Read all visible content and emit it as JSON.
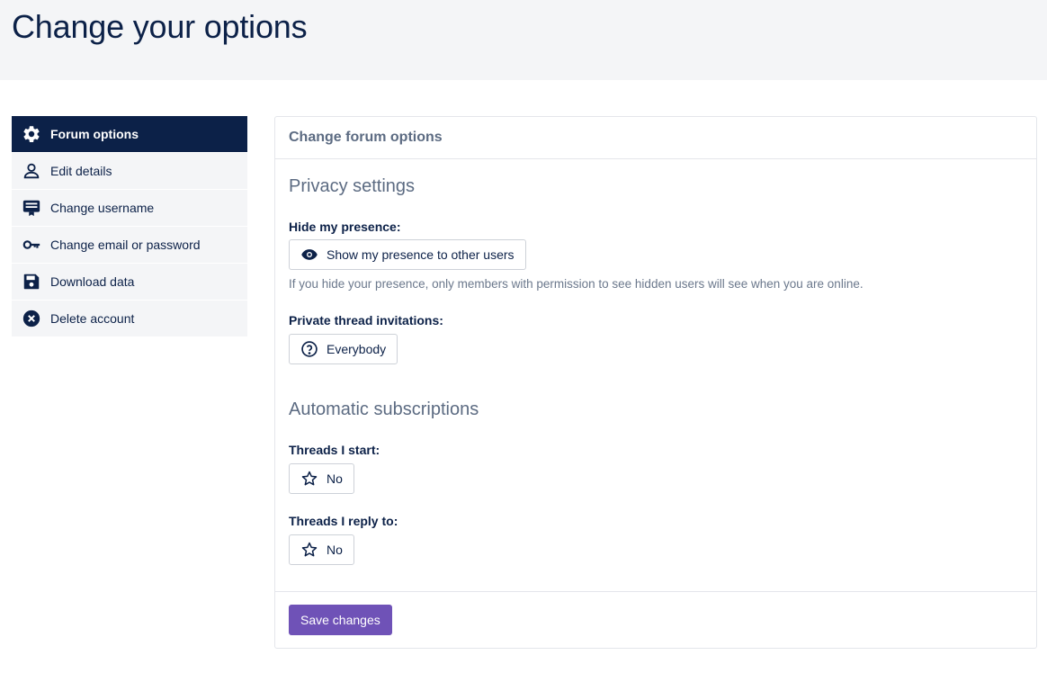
{
  "page": {
    "title": "Change your options"
  },
  "sidebar": {
    "items": [
      {
        "label": "Forum options",
        "icon": "gear-icon",
        "active": true
      },
      {
        "label": "Edit details",
        "icon": "user-icon",
        "active": false
      },
      {
        "label": "Change username",
        "icon": "id-card-icon",
        "active": false
      },
      {
        "label": "Change email or password",
        "icon": "key-icon",
        "active": false
      },
      {
        "label": "Download data",
        "icon": "floppy-disk-icon",
        "active": false
      },
      {
        "label": "Delete account",
        "icon": "x-circle-icon",
        "active": false
      }
    ]
  },
  "panel": {
    "title": "Change forum options",
    "privacy": {
      "heading": "Privacy settings",
      "presence_label": "Hide my presence:",
      "presence_value": "Show my presence to other users",
      "presence_icon": "eye-icon",
      "presence_help": "If you hide your presence, only members with permission to see hidden users will see when you are online.",
      "invitations_label": "Private thread invitations:",
      "invitations_value": "Everybody",
      "invitations_icon": "question-circle-icon"
    },
    "subscriptions": {
      "heading": "Automatic subscriptions",
      "threads_start_label": "Threads I start:",
      "threads_start_value": "No",
      "threads_reply_label": "Threads I reply to:",
      "threads_reply_value": "No",
      "icon": "star-outline-icon"
    },
    "save_label": "Save changes"
  },
  "colors": {
    "navy": "#0c2148",
    "accent": "#6f52b7",
    "muted": "#5c6b82",
    "header_bg": "#f4f5f7"
  }
}
